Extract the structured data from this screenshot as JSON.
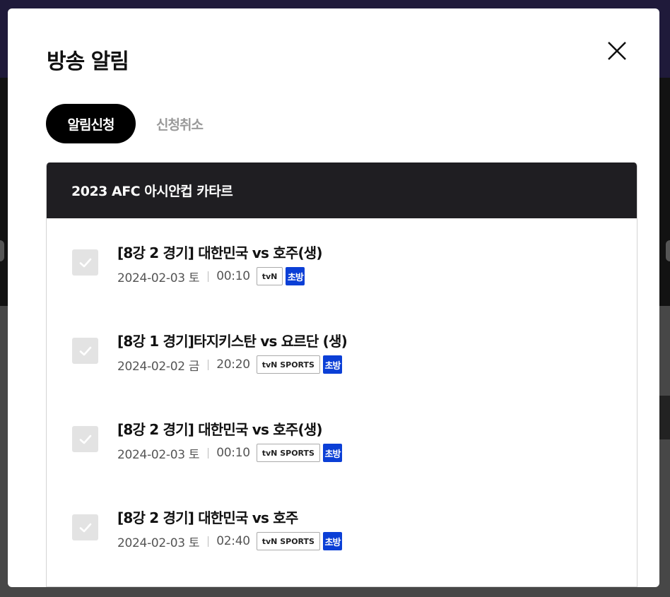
{
  "modal": {
    "title": "방송 알림",
    "close_icon": "close-icon"
  },
  "tabs": [
    {
      "label": "알림신청",
      "active": true
    },
    {
      "label": "신청취소",
      "active": false
    }
  ],
  "panel": {
    "header": "2023 AFC 아시안컵 카타르",
    "programs": [
      {
        "title": "[8강 2 경기] 대한민국 vs 호주(생)",
        "date": "2024-02-03 토",
        "time": "00:10",
        "channel": "tvN",
        "badge": "초방",
        "checked": true
      },
      {
        "title": "[8강 1 경기]타지키스탄 vs 요르단 (생)",
        "date": "2024-02-02 금",
        "time": "20:20",
        "channel": "tvN SPORTS",
        "badge": "초방",
        "checked": true
      },
      {
        "title": "[8강 2 경기] 대한민국 vs 호주(생)",
        "date": "2024-02-03 토",
        "time": "00:10",
        "channel": "tvN SPORTS",
        "badge": "초방",
        "checked": true
      },
      {
        "title": "[8강 2 경기] 대한민국 vs 호주",
        "date": "2024-02-03 토",
        "time": "02:40",
        "channel": "tvN SPORTS",
        "badge": "초방",
        "checked": true
      }
    ]
  },
  "colors": {
    "header_bg": "#1f1e22",
    "premiere_badge": "#0b3fd6",
    "active_tab": "#000000",
    "inactive_tab_text": "#9a9a9a"
  }
}
